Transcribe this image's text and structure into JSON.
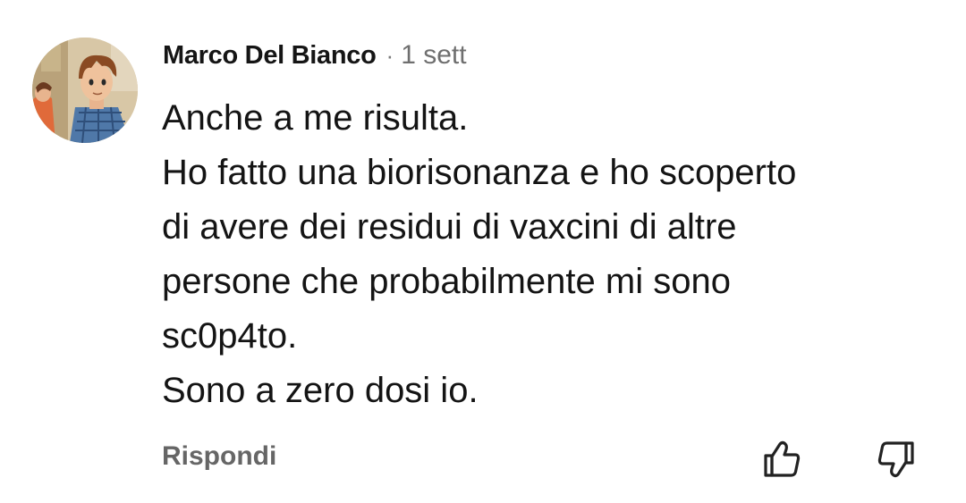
{
  "comment": {
    "author": "Marco Del Bianco",
    "separator": "·",
    "time": "1 sett",
    "text_lines": [
      "Anche a me risulta.",
      "Ho fatto una biorisonanza e ho scoperto",
      "di avere dei residui di vaxcini di altre",
      "persone che probabilmente mi sono",
      "sc0p4to.",
      "Sono a zero dosi io."
    ],
    "reply_label": "Rispondi",
    "avatar_icon": "avatar-illustration",
    "like_icon": "thumbs-up-icon",
    "dislike_icon": "thumbs-down-icon"
  },
  "colors": {
    "background": "#ffffff",
    "text": "#141414",
    "muted": "#666666"
  }
}
